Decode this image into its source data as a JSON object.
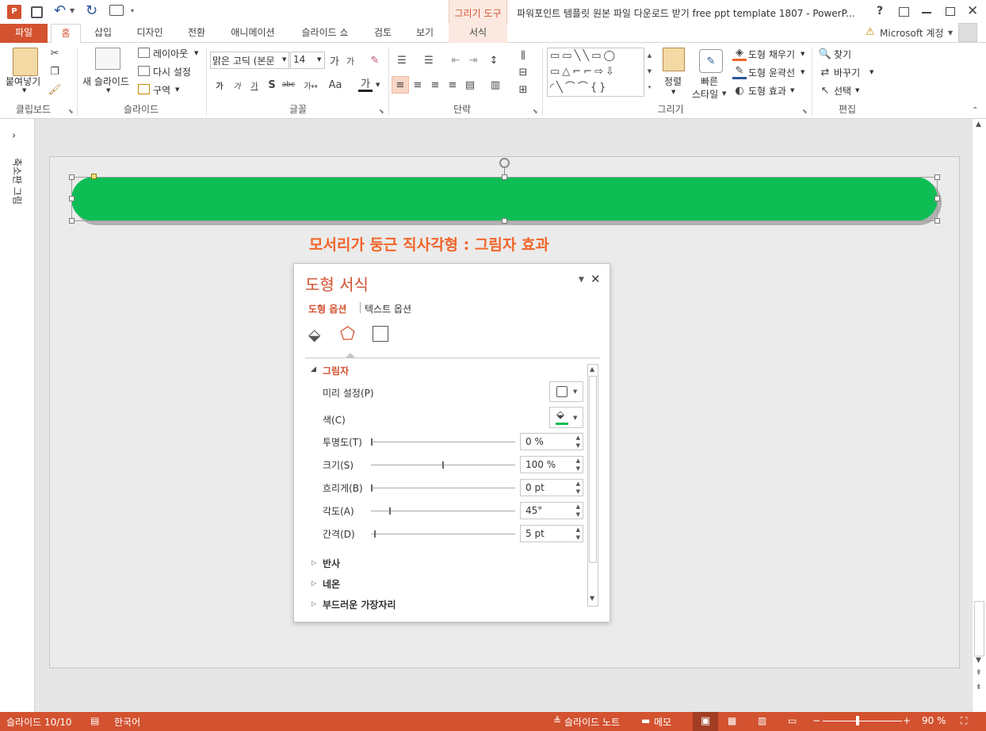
{
  "window": {
    "title": "파워포인트 템플릿 원본 파일 다운로드 받기 free ppt template 1807 - PowerP...",
    "context_tab_group": "그리기 도구",
    "help": "?",
    "account": "Microsoft 계정"
  },
  "tabs": {
    "file": "파일",
    "items": [
      "홈",
      "삽입",
      "디자인",
      "전환",
      "애니메이션",
      "슬라이드 쇼",
      "검토",
      "보기"
    ],
    "format": "서식"
  },
  "ribbon": {
    "clipboard": {
      "label": "클립보드",
      "paste": "붙여넣기"
    },
    "slides": {
      "label": "슬라이드",
      "new_slide": "새 슬라이드",
      "layout": "레이아웃",
      "reset": "다시 설정",
      "section": "구역"
    },
    "font": {
      "label": "글꼴",
      "font_name": "맑은 고딕 (본문",
      "font_size": "14"
    },
    "paragraph": {
      "label": "단락"
    },
    "drawing": {
      "label": "그리기",
      "arrange": "정렬",
      "quick_styles": "빠른\n스타일",
      "quick1": "빠른",
      "quick2": "스타일",
      "fill": "도형 채우기",
      "outline": "도형 윤곽선",
      "effects": "도형 효과"
    },
    "editing": {
      "label": "편집",
      "find": "찾기",
      "replace": "바꾸기",
      "select": "선택"
    }
  },
  "left_pane": {
    "label": "축소판 그림"
  },
  "slide": {
    "caption": "모서리가 둥근 직사각형 : 그림자 효과",
    "shape_color": "#0ebe55",
    "caption_color": "#f1652a"
  },
  "format_panel": {
    "title": "도형 서식",
    "tab_shape": "도형 옵션",
    "tab_text": "텍스트 옵션",
    "section": "그림자",
    "presets_label": "미리 설정(P)",
    "color_label": "색(C)",
    "rows": [
      {
        "label": "투명도(T)",
        "value": "0 %",
        "level": 0
      },
      {
        "label": "크기(S)",
        "value": "100 %",
        "level": 0.5
      },
      {
        "label": "흐리게(B)",
        "value": "0 pt",
        "level": 0
      },
      {
        "label": "각도(A)",
        "value": "45°",
        "level": 0.125
      },
      {
        "label": "간격(D)",
        "value": "5 pt",
        "level": 0.02
      }
    ],
    "collapsed": [
      "반사",
      "네온",
      "부드러운 가장자리"
    ]
  },
  "status": {
    "slide": "슬라이드 10/10",
    "language": "한국어",
    "notes": "슬라이드 노트",
    "comments": "메모",
    "zoom": "90 %"
  }
}
